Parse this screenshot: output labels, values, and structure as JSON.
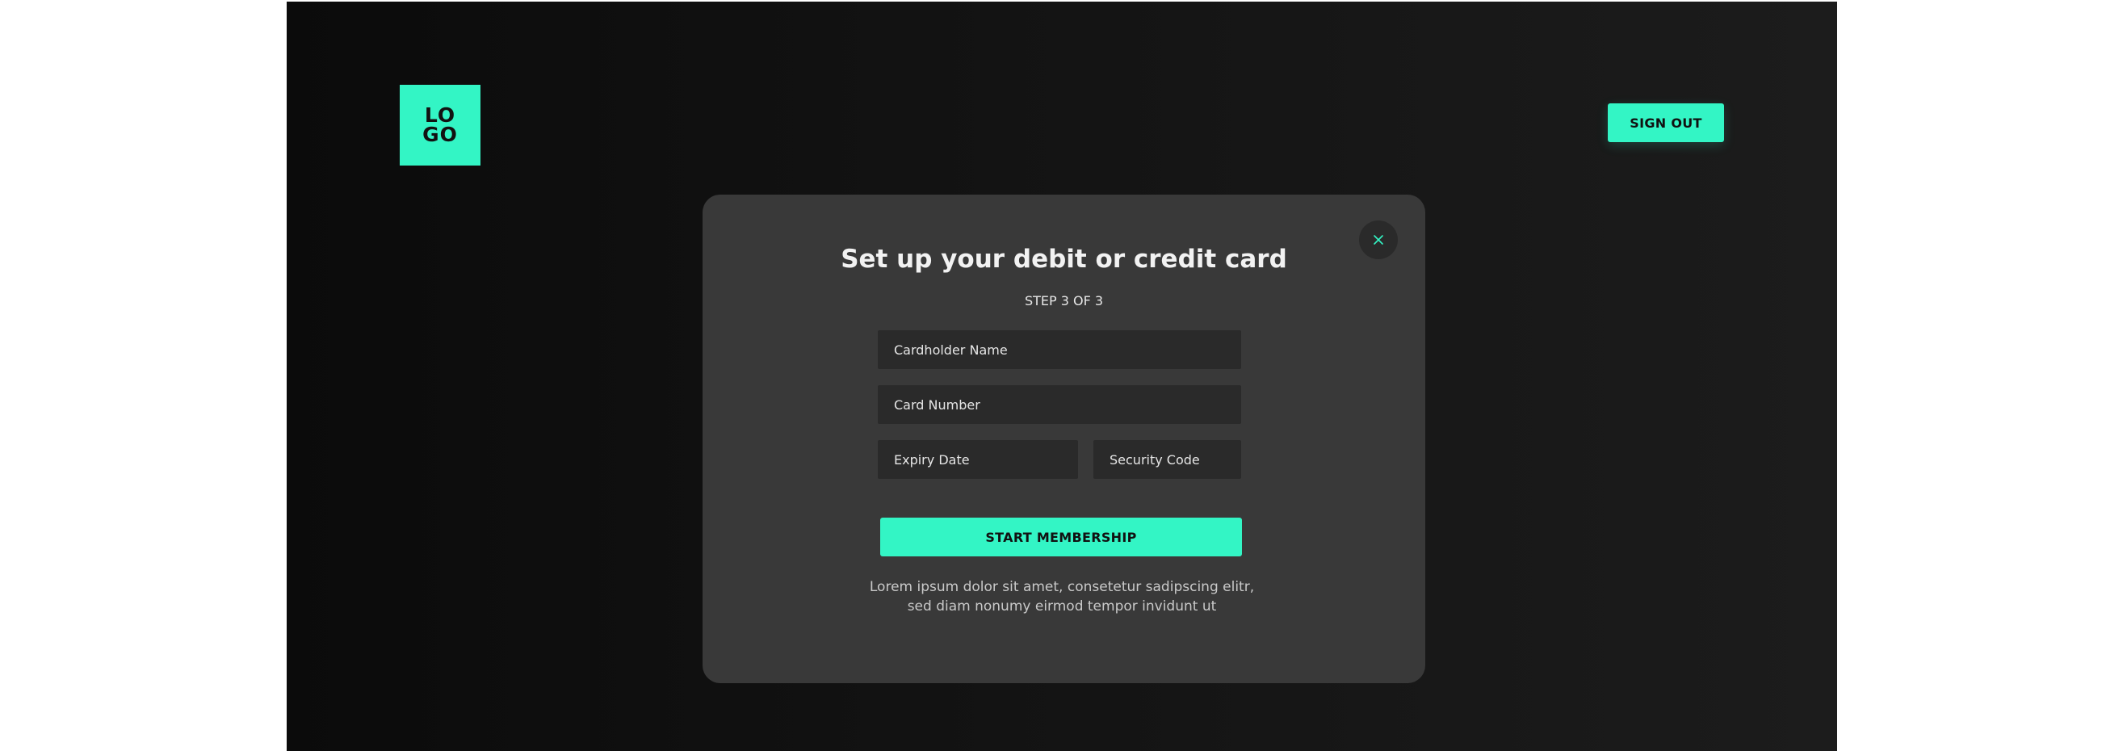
{
  "header": {
    "logo_line1": "LO",
    "logo_line2": "GO",
    "signout_label": "SIGN OUT"
  },
  "modal": {
    "close_label": "×",
    "title": "Set up your debit or credit card",
    "step": "STEP 3 OF 3",
    "fields": {
      "cardholder_placeholder": "Cardholder Name",
      "card_number_placeholder": "Card Number",
      "expiry_placeholder": "Expiry Date",
      "security_code_placeholder": "Security Code"
    },
    "submit_label": "START MEMBERSHIP",
    "legal_text": "Lorem ipsum dolor sit amet, consetetur sadipscing elitr, sed diam nonumy eirmod tempor invidunt ut"
  },
  "colors": {
    "accent": "#33f5c5",
    "modal_bg": "#393939",
    "field_bg": "#2a2a2a",
    "page_bg_dark": "#0b0b0b",
    "page_bg_light": "#1c1c1c"
  },
  "icons": {
    "close": "close-icon"
  }
}
